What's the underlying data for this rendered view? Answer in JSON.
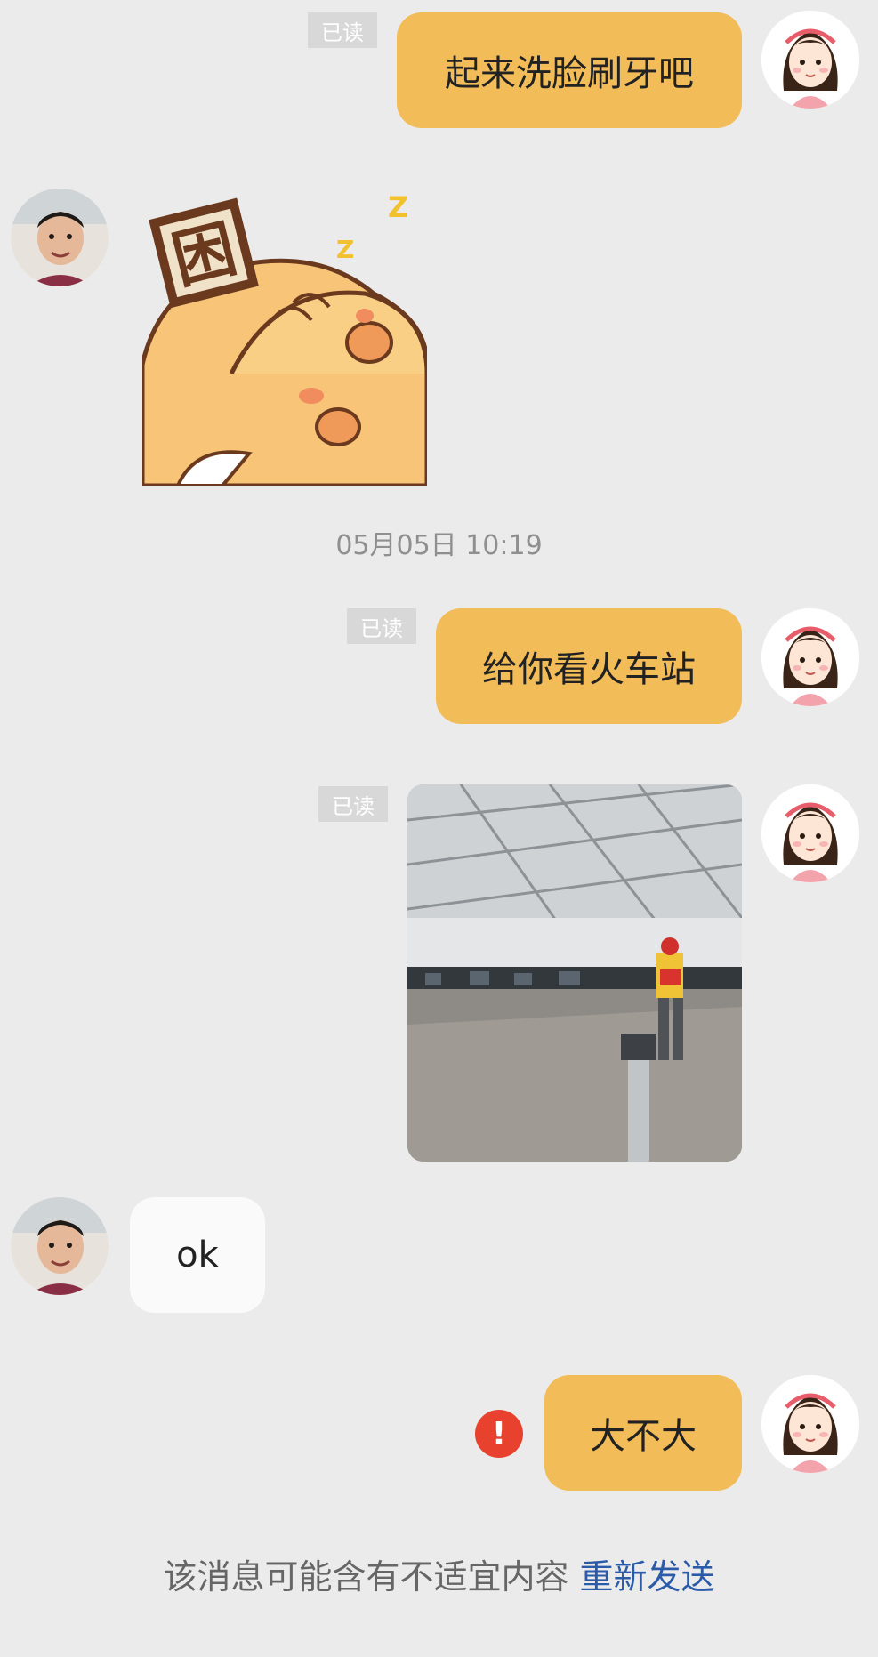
{
  "messages": [
    {
      "side": "me",
      "type": "text",
      "text": "起来洗脸刷牙吧",
      "read": "已读"
    },
    {
      "side": "other",
      "type": "sticker",
      "sticker_icon": "sleepy-chick-sticker",
      "sticker_text": "困",
      "sleep_z": "Z"
    },
    {
      "type": "timestamp",
      "text": "05月05日 10:19"
    },
    {
      "side": "me",
      "type": "text",
      "text": "给你看火车站",
      "read": "已读"
    },
    {
      "side": "me",
      "type": "image",
      "image_icon": "train-station-photo",
      "read": "已读"
    },
    {
      "side": "other",
      "type": "text",
      "text": "ok"
    },
    {
      "side": "me",
      "type": "text",
      "text": "大不大",
      "status_icon": "warning-icon",
      "status_glyph": "!"
    }
  ],
  "notice": {
    "text": "该消息可能含有不适宜内容",
    "action": "重新发送"
  },
  "colors": {
    "my_bubble": "#f2bd59",
    "other_bubble": "#fafafa",
    "warning": "#e8422e",
    "resend_link": "#2b5aa8"
  }
}
